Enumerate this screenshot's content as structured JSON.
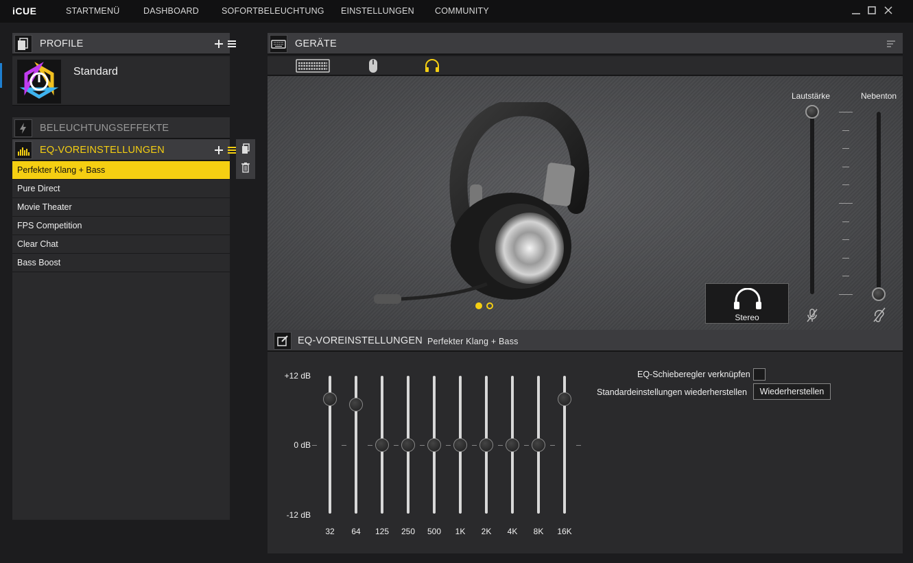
{
  "app": {
    "logo": "iCUE"
  },
  "nav": [
    "STARTMENÜ",
    "DASHBOARD",
    "SOFORTBELEUCHTUNG",
    "EINSTELLUNGEN",
    "COMMUNITY"
  ],
  "profiles": {
    "title": "PROFILE",
    "current": "Standard"
  },
  "lighting": {
    "title": "BELEUCHTUNGSEFFEKTE"
  },
  "eq_presets": {
    "title": "EQ-VOREINSTELLUNGEN",
    "items": [
      "Perfekter Klang + Bass",
      "Pure Direct",
      "Movie Theater",
      "FPS Competition",
      "Clear Chat",
      "Bass Boost"
    ],
    "active_index": 0
  },
  "devices": {
    "title": "GERÄTE",
    "tabs": [
      "keyboard-icon",
      "mouse-icon",
      "headset-icon"
    ],
    "active_tab": 2,
    "image_page": {
      "current": 1,
      "total": 2
    }
  },
  "audio": {
    "mode": "Stereo",
    "volume_label": "Lautstärke",
    "sidetone_label": "Nebenton",
    "volume_level": 1.0,
    "sidetone_level": 0.0
  },
  "eq": {
    "title": "EQ-VOREINSTELLUNGEN",
    "preset_name": "Perfekter Klang + Bass",
    "db_labels": [
      "+12 dB",
      "0 dB",
      "-12 dB"
    ],
    "range_db": [
      -12,
      12
    ],
    "bands": [
      {
        "freq": "32",
        "gain_db": 8
      },
      {
        "freq": "64",
        "gain_db": 7
      },
      {
        "freq": "125",
        "gain_db": 0
      },
      {
        "freq": "250",
        "gain_db": 0
      },
      {
        "freq": "500",
        "gain_db": 0
      },
      {
        "freq": "1K",
        "gain_db": 0
      },
      {
        "freq": "2K",
        "gain_db": 0
      },
      {
        "freq": "4K",
        "gain_db": 0
      },
      {
        "freq": "8K",
        "gain_db": 0
      },
      {
        "freq": "16K",
        "gain_db": 8
      }
    ],
    "link_label": "EQ-Schieberegler verknüpfen",
    "link_checked": false,
    "reset_label": "Standardeinstellungen wiederherstellen",
    "reset_button": "Wiederherstellen"
  },
  "colors": {
    "accent": "#f5cf12",
    "panel": "#2a2a2c",
    "header": "#3c3c3f"
  }
}
